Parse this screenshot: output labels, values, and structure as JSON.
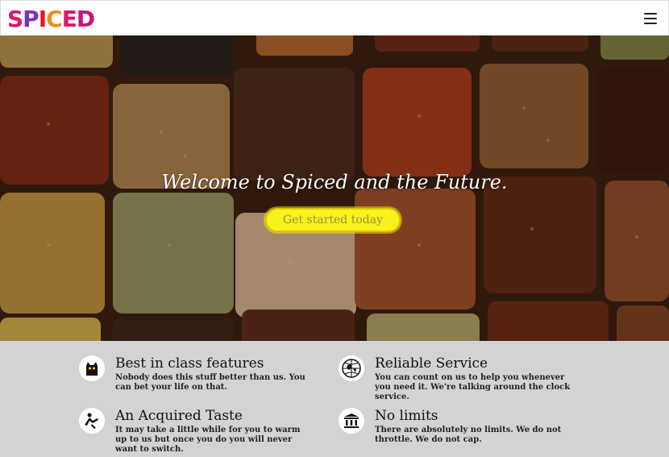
{
  "brand": {
    "letters": [
      "S",
      "P",
      "I",
      "C",
      "E",
      "D"
    ],
    "colors": [
      "#e0176a",
      "#7b2fbf",
      "#e8151b",
      "#f18a1e",
      "#e0176a",
      "#c8147a"
    ]
  },
  "nav": {
    "menu_icon": "hamburger-menu-icon"
  },
  "hero": {
    "title": "Welcome to Spiced and the Future.",
    "cta_label": "Get started today",
    "cta_color": "#f7f21c"
  },
  "features": [
    {
      "icon": "cat-icon",
      "title": "Best in class features",
      "text": "Nobody does this stuff better than us. You can bet your life on that."
    },
    {
      "icon": "globe-icon",
      "title": "Reliable Service",
      "text": "You can count on us to help you whenever you need it. We're talking around the clock service."
    },
    {
      "icon": "person-icon",
      "title": "An Acquired Taste",
      "text": "It may take a little while for you to warm up to us but once you do you will never want to switch."
    },
    {
      "icon": "building-icon",
      "title": "No limits",
      "text": "There are absolutely no limits. We do not throttle. We do not cap."
    }
  ]
}
